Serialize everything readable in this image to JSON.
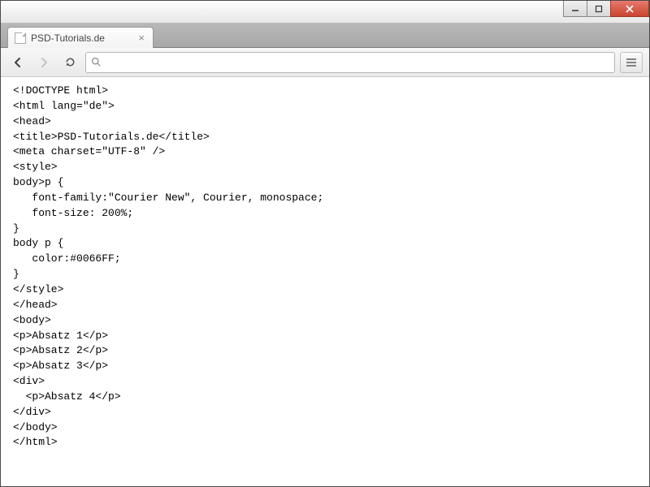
{
  "tab": {
    "title": "PSD-Tutorials.de"
  },
  "addressbar": {
    "value": ""
  },
  "code_lines": [
    "<!DOCTYPE html>",
    "<html lang=\"de\">",
    "<head>",
    "<title>PSD-Tutorials.de</title>",
    "<meta charset=\"UTF-8\" />",
    "<style>",
    "body>p {",
    "   font-family:\"Courier New\", Courier, monospace;",
    "   font-size: 200%;",
    "}",
    "body p {",
    "   color:#0066FF;",
    "}",
    "</style>",
    "</head>",
    "<body>",
    "<p>Absatz 1</p>",
    "<p>Absatz 2</p>",
    "<p>Absatz 3</p>",
    "<div>",
    "  <p>Absatz 4</p>",
    "</div>",
    "</body>",
    "</html>"
  ]
}
